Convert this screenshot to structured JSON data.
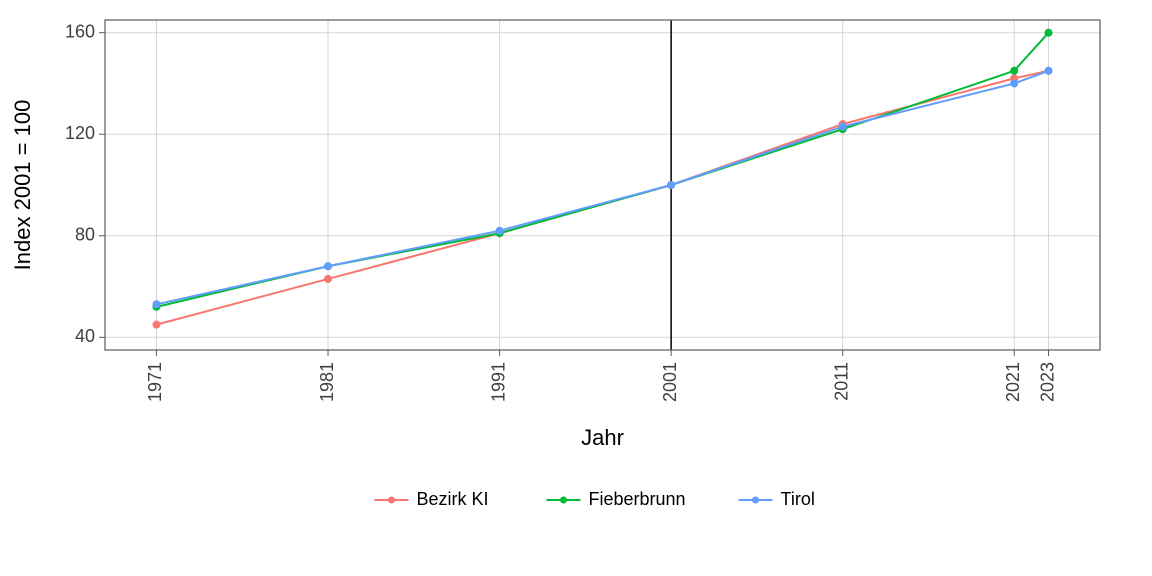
{
  "chart_data": {
    "type": "line",
    "xlabel": "Jahr",
    "ylabel": "Index 2001 = 100",
    "x_ticks": [
      1971,
      1981,
      1991,
      2001,
      2011,
      2021,
      2023
    ],
    "y_ticks": [
      40,
      80,
      120,
      160
    ],
    "ylim": [
      35,
      165
    ],
    "xlim": [
      1968,
      2026
    ],
    "reference_x": 2001,
    "grid": true,
    "series": [
      {
        "name": "Bezirk KI",
        "color": "#F8766D",
        "x": [
          1971,
          1981,
          1991,
          2001,
          2011,
          2021,
          2023
        ],
        "y": [
          45,
          63,
          81,
          100,
          124,
          142,
          145
        ]
      },
      {
        "name": "Fieberbrunn",
        "color": "#00BA38",
        "x": [
          1971,
          1981,
          1991,
          2001,
          2011,
          2021,
          2023
        ],
        "y": [
          52,
          68,
          81,
          100,
          122,
          145,
          160
        ]
      },
      {
        "name": "Tirol",
        "color": "#619CFF",
        "x": [
          1971,
          1981,
          1991,
          2001,
          2011,
          2021,
          2023
        ],
        "y": [
          53,
          68,
          82,
          100,
          123,
          140,
          145
        ]
      }
    ]
  }
}
